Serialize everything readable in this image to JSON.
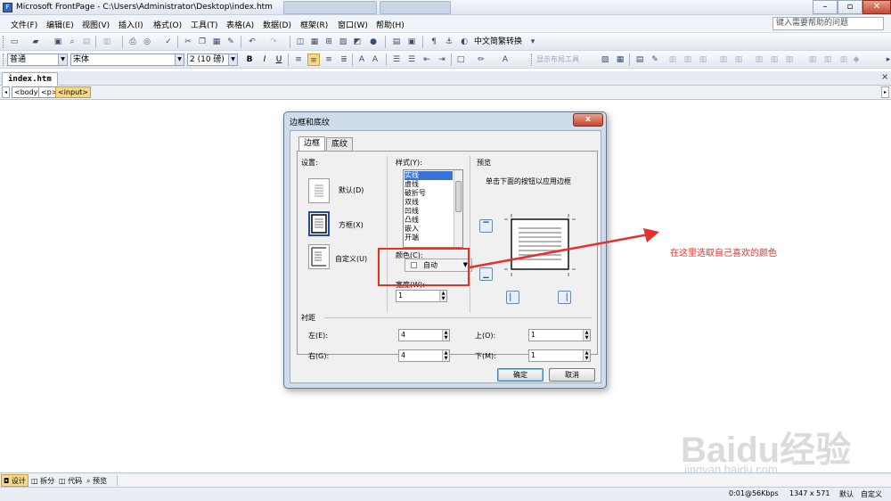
{
  "window": {
    "title": "Microsoft FrontPage - C:\\Users\\Administrator\\Desktop\\index.htm",
    "controls": [
      "–",
      "▫",
      "✕"
    ]
  },
  "menu": {
    "items": [
      "文件(F)",
      "编辑(E)",
      "视图(V)",
      "插入(I)",
      "格式(O)",
      "工具(T)",
      "表格(A)",
      "数据(D)",
      "框架(R)",
      "窗口(W)",
      "帮助(H)"
    ],
    "help_placeholder": "键入需要帮助的问题"
  },
  "toolbar1": {
    "zh_convert": "中文简繁转换"
  },
  "toolbar2": {
    "style": "普通",
    "font": "宋体",
    "size": "2 (10 磅)",
    "bold": "B",
    "italic": "I",
    "underline": "U",
    "layout_tools": "显示布局工具"
  },
  "document": {
    "tab": "index.htm",
    "close": "×",
    "tags": [
      "<body>",
      "<p>",
      "<input>"
    ]
  },
  "dialog": {
    "title": "边框和底纹",
    "close": "x",
    "tabs": [
      "边框",
      "底纹"
    ],
    "settings_label": "设置:",
    "settings": [
      "默认(D)",
      "方框(X)",
      "自定义(U)"
    ],
    "style_label": "样式(Y):",
    "styles": [
      "实线",
      "虚线",
      "破折号",
      "双线",
      "凹线",
      "凸线",
      "嵌入",
      "开端"
    ],
    "color_label": "颜色(C):",
    "color_value": "自动",
    "width_label": "宽度(W):",
    "width_value": "1",
    "preview_label": "预览",
    "preview_hint": "单击下面的按钮以应用边框",
    "padding_label": "衬距",
    "padding": {
      "left_label": "左(E):",
      "left_value": "4",
      "right_label": "右(G):",
      "right_value": "4",
      "top_label": "上(O):",
      "top_value": "1",
      "bottom_label": "下(M):",
      "bottom_value": "1"
    },
    "ok": "确定",
    "cancel": "取消"
  },
  "annotation": {
    "text": "在这里选取自己喜欢的颜色",
    "color": "#e8302a"
  },
  "views": [
    "设计",
    "拆分",
    "代码",
    "预览"
  ],
  "status": {
    "speed": "0:01@56Kbps",
    "size": "1347 x 571",
    "mode": "默认",
    "type": "自定义"
  },
  "watermark": {
    "logo": "Baidu经验",
    "url": "jingyan.baidu.com"
  }
}
